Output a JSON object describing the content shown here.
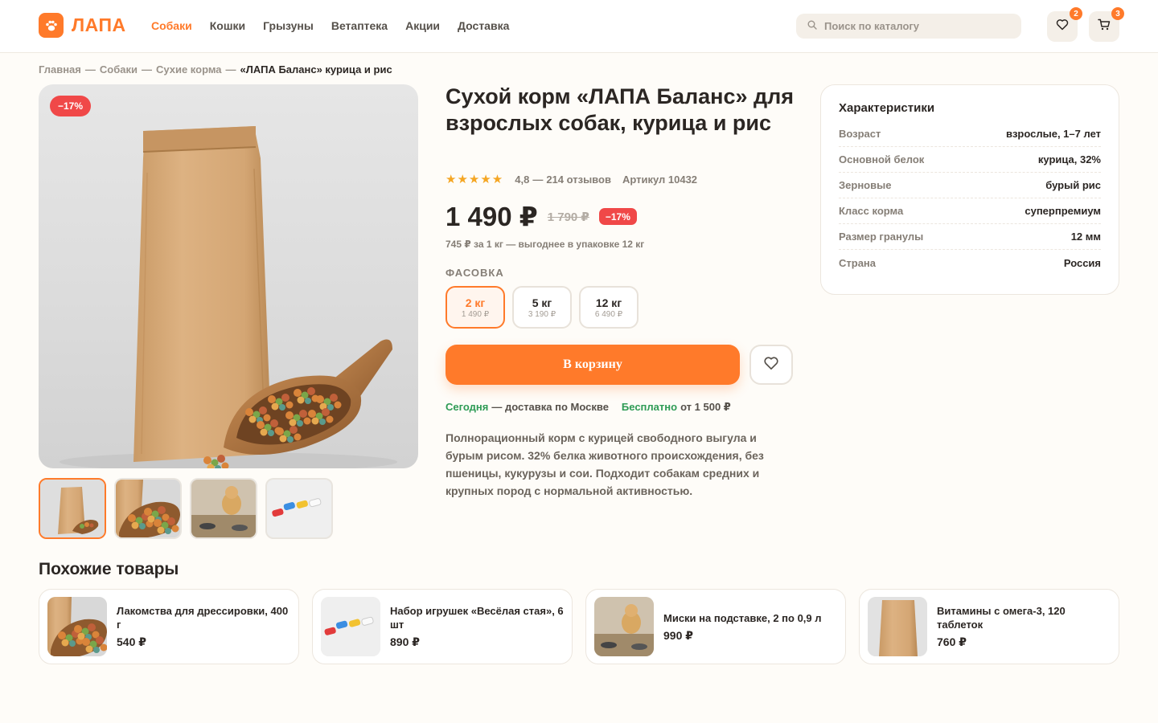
{
  "brand": {
    "name": "ЛАПА",
    "logo_icon": "paw-icon",
    "accent": "#ff7a2a"
  },
  "nav": [
    {
      "label": "Собаки",
      "active": true
    },
    {
      "label": "Кошки"
    },
    {
      "label": "Грызуны"
    },
    {
      "label": "Ветаптека"
    },
    {
      "label": "Акции"
    },
    {
      "label": "Доставка"
    }
  ],
  "search": {
    "placeholder": "Поиск по каталогу",
    "value": ""
  },
  "header_actions": {
    "favorites": {
      "icon": "heart-icon",
      "count": "2"
    },
    "cart": {
      "icon": "cart-icon",
      "count": "3"
    }
  },
  "breadcrumb": {
    "items": [
      "Главная",
      "Собаки",
      "Сухие корма"
    ],
    "separator": "—",
    "current": "«ЛАПА Баланс» курица и рис"
  },
  "gallery": {
    "badge": "−17%",
    "thumbnails": [
      "bag-with-scoop",
      "scoop-with-kibble",
      "dog-with-bowls",
      "toy-bones"
    ],
    "active_index": 0
  },
  "product": {
    "title": "Сухой корм «ЛАПА Баланс» для взрослых собак, курица и рис",
    "stars": "★★★★★",
    "rating": "4,8",
    "reviews": "214 отзывов",
    "sku": "Артикул 10432",
    "price": "1 490 ₽",
    "old_price": "1 790 ₽",
    "discount": "−17%",
    "unit_price": "745 ₽ за 1 кг — выгоднее в упаковке 12 кг",
    "pack_label": "ФАСОВКА",
    "packs": [
      {
        "weight": "2 кг",
        "price": "1 490 ₽",
        "selected": true
      },
      {
        "weight": "5 кг",
        "price": "3 190 ₽"
      },
      {
        "weight": "12 кг",
        "price": "6 490 ₽"
      }
    ],
    "cart_button": "В корзину",
    "delivery": {
      "today": "Сегодня",
      "today_text": "— доставка по Москве",
      "free": "Бесплатно",
      "free_text": "от 1 500 ₽"
    },
    "description": "Полнорационный корм с курицей свободного выгула и бурым рисом. 32% белка животного происхождения, без пшеницы, кукурузы и сои. Подходит собакам средних и крупных пород с нормальной активностью."
  },
  "specs": {
    "title": "Характеристики",
    "rows": [
      {
        "k": "Возраст",
        "v": "взрослые, 1–7 лет"
      },
      {
        "k": "Основной белок",
        "v": "курица, 32%"
      },
      {
        "k": "Зерновые",
        "v": "бурый рис"
      },
      {
        "k": "Класс корма",
        "v": "суперпремиум"
      },
      {
        "k": "Размер гранулы",
        "v": "12 мм"
      },
      {
        "k": "Страна",
        "v": "Россия"
      }
    ]
  },
  "similar": {
    "title": "Похожие товары",
    "items": [
      {
        "name": "Лакомства для дрессировки, 400 г",
        "price": "540 ₽",
        "image": "scoop-with-kibble"
      },
      {
        "name": "Набор игрушек «Весёлая стая», 6 шт",
        "price": "890 ₽",
        "image": "toy-bones"
      },
      {
        "name": "Миски на подставке, 2 по 0,9 л",
        "price": "990 ₽",
        "image": "dog-with-bowls"
      },
      {
        "name": "Витамины с омега-3, 120 таблеток",
        "price": "760 ₽",
        "image": "paper-bag"
      }
    ]
  },
  "colors": {
    "accent": "#ff7a2a",
    "sale": "#f04848",
    "success": "#2e9b55",
    "star": "#f5a623"
  }
}
